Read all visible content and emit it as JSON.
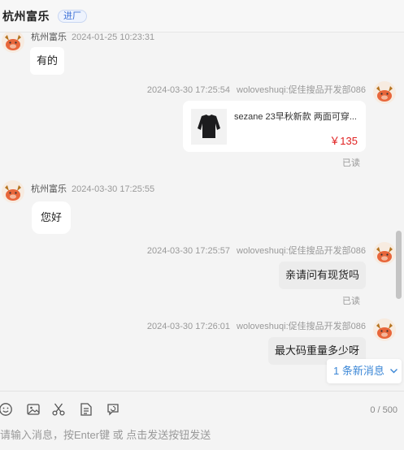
{
  "header": {
    "title": "杭州富乐",
    "badge": "进厂"
  },
  "messages": [
    {
      "sender": "杭州富乐",
      "time": "2024-01-25 10:23:31",
      "text": "有的"
    },
    {
      "sender": "woloveshuqi:促佳搜品开发部086",
      "time": "2024-03-30 17:25:54",
      "product": {
        "title": "sezane 23早秋新款 两面可穿...",
        "price": "￥135"
      },
      "status": "已读"
    },
    {
      "sender": "杭州富乐",
      "time": "2024-03-30 17:25:55",
      "text": "您好"
    },
    {
      "sender": "woloveshuqi:促佳搜品开发部086",
      "time": "2024-03-30 17:25:57",
      "text": "亲请问有现货吗",
      "status": "已读"
    },
    {
      "sender": "woloveshuqi:促佳搜品开发部086",
      "time": "2024-03-30 17:26:01",
      "text": "最大码重量多少呀"
    }
  ],
  "new_messages": "1 条新消息",
  "composer": {
    "counter": "0 / 500",
    "placeholder": "请输入消息，按Enter键 或 点击发送按钮发送"
  },
  "icons": [
    "emoji-icon",
    "image-icon",
    "scissors-icon",
    "document-icon",
    "chat-refresh-icon",
    "chevron-down-icon"
  ],
  "colors": {
    "accent_blue": "#3a86d6",
    "price_red": "#e02020"
  }
}
